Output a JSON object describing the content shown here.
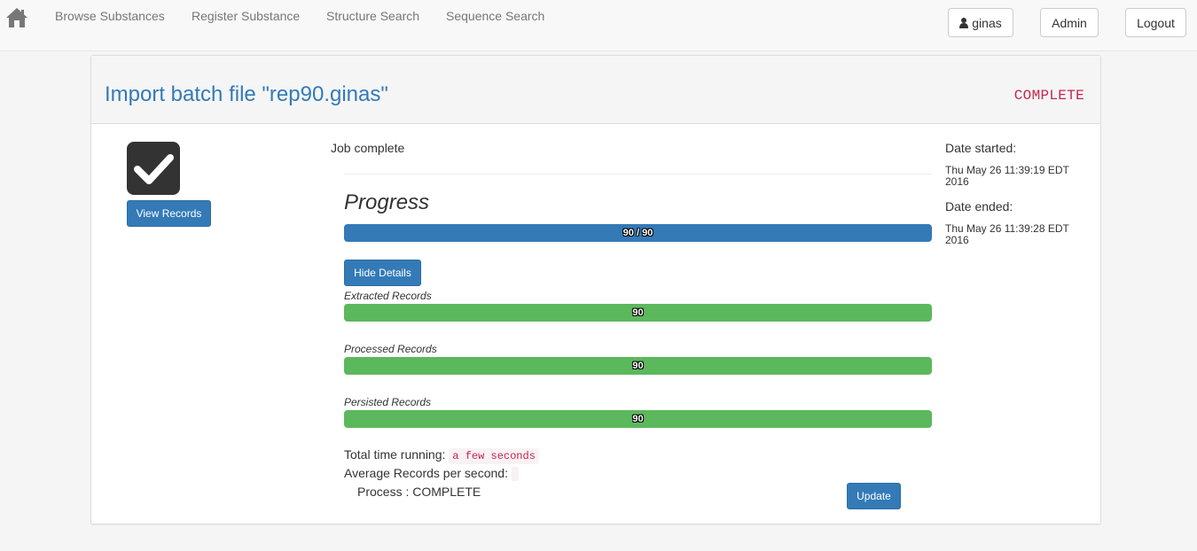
{
  "nav": {
    "links": [
      "Browse Substances",
      "Register Substance",
      "Structure Search",
      "Sequence Search"
    ],
    "user_label": "ginas",
    "admin_label": "Admin",
    "logout_label": "Logout"
  },
  "panel": {
    "title": "Import batch file \"rep90.ginas\"",
    "status": "COMPLETE",
    "view_records_label": "View Records",
    "job_status": "Job complete"
  },
  "progress": {
    "title": "Progress",
    "overall_label": "90 / 90",
    "overall_fraction": 1.0,
    "hide_details_label": "Hide Details",
    "details": [
      {
        "label": "Extracted Records",
        "value": "90",
        "fraction": 1.0
      },
      {
        "label": "Processed Records",
        "value": "90",
        "fraction": 1.0
      },
      {
        "label": "Persisted Records",
        "value": "90",
        "fraction": 1.0
      }
    ]
  },
  "stats": {
    "total_time_label": "Total time running:",
    "total_time_value": "a few seconds",
    "avg_label": "Average Records per second:",
    "process_line": "Process : COMPLETE",
    "update_label": "Update"
  },
  "meta": {
    "date_started_label": "Date started:",
    "date_started_value": "Thu May 26 11:39:19 EDT 2016",
    "date_ended_label": "Date ended:",
    "date_ended_value": "Thu May 26 11:39:28 EDT 2016"
  },
  "colors": {
    "primary": "#337ab7",
    "success": "#5cb85c",
    "code": "#c7254e"
  },
  "icons": {
    "home": "home-icon",
    "user": "user-icon",
    "complete": "check-square-icon"
  }
}
